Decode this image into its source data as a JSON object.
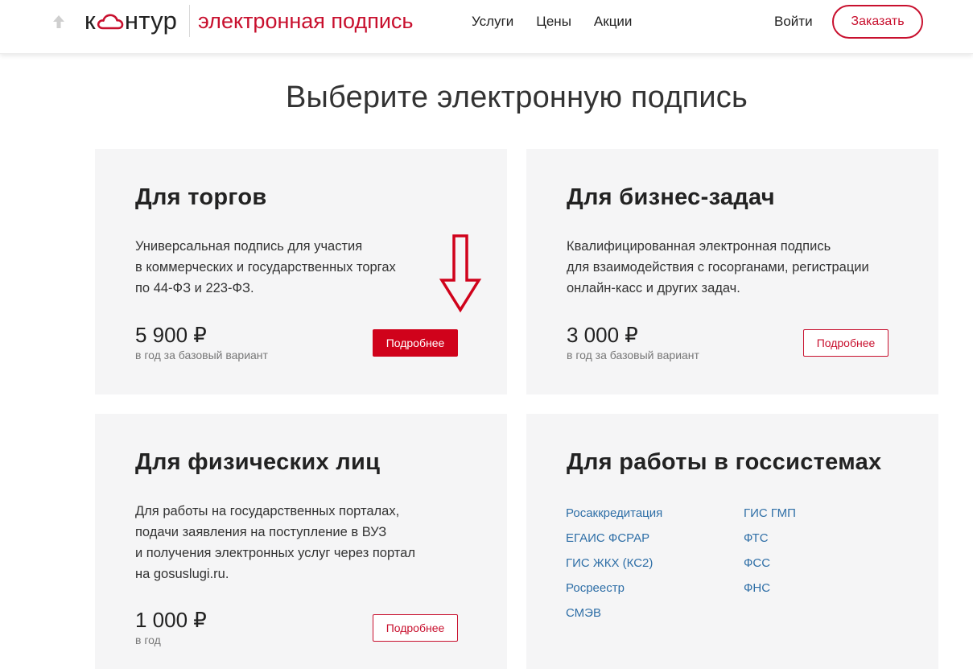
{
  "header": {
    "logo_left": "к",
    "logo_right": "нтур",
    "product_title": "электронная подпись",
    "nav": [
      "Услуги",
      "Цены",
      "Акции"
    ],
    "login_label": "Войти",
    "order_label": "Заказать"
  },
  "page_heading": "Выберите электронную подпись",
  "cards": [
    {
      "title": "Для торгов",
      "desc": [
        "Универсальная подпись для участия",
        "в коммерческих и государственных торгах",
        "по 44-ФЗ и 223-ФЗ."
      ],
      "price": "5 900 ₽",
      "price_note": "в год за базовый вариант",
      "button_label": "Подробнее"
    },
    {
      "title": "Для бизнес-задач",
      "desc": [
        "Квалифицированная электронная подпись",
        "для взаимодействия с госорганами, регистрации",
        "онлайн-касс и других задач."
      ],
      "price": "3 000 ₽",
      "price_note": "в год за базовый вариант",
      "button_label": "Подробнее"
    },
    {
      "title": "Для физических лиц",
      "desc": [
        "Для работы на государственных порталах,",
        "подачи заявления на поступление в ВУЗ",
        "и получения электронных услуг через портал",
        "на gosuslugi.ru."
      ],
      "price": "1 000 ₽",
      "price_note": "в год",
      "button_label": "Подробнее"
    },
    {
      "title": "Для работы в госсистемах",
      "links_col1": [
        "Росаккредитация",
        "ЕГАИС ФСРАР",
        "ГИС ЖКХ (КС2)",
        "Росреестр",
        "СМЭВ"
      ],
      "links_col2": [
        "ГИС ГМП",
        "ФТС",
        "ФСС",
        "ФНС"
      ]
    }
  ],
  "colors": {
    "brand_red": "#c8102e",
    "button_red": "#d0021b",
    "card_bg": "#f5f5f6",
    "link_blue": "#2f6fa7"
  },
  "icons": [
    "scroll-up-arrow-icon",
    "cloud-logo-icon",
    "down-arrow-annotation-icon"
  ]
}
